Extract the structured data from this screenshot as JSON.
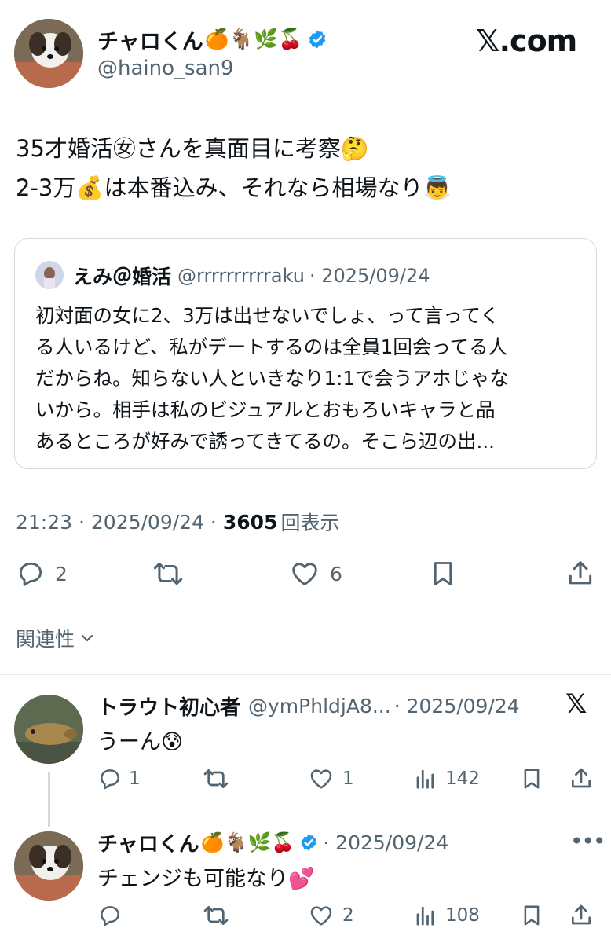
{
  "main_tweet": {
    "author_name": "チャロくん",
    "author_emoji": "🍊🐐🌿🍒",
    "handle": "@haino_san9",
    "site_label": "𝕏.com",
    "text_line1": "35才婚活㊛さんを真面目に考察🤔",
    "text_line2": "2-3万💰は本番込み、それなら相場なり👼",
    "quote": {
      "author_name": "えみ＠婚活",
      "handle": "@rrrrrrrrrraku",
      "date": "· 2025/09/24",
      "lines": [
        "初対面の女に2、3万は出せないでしょ、って言ってく",
        "る人いるけど、私がデートするのは全員1回会ってる人",
        "だからね。知らない人といきなり1:1で会うアホじゃな",
        "いから。相手は私のビジュアルとおもろいキャラと品",
        "あるところが好みで誘ってきてるの。そこら辺の出..."
      ]
    },
    "time": "21:23 · 2025/09/24 ·",
    "views_count": "3605",
    "views_label": "回表示",
    "actions": {
      "reply_count": "2",
      "like_count": "6"
    },
    "related_label": "関連性"
  },
  "replies": [
    {
      "author_name": "トラウト初心者",
      "handle": "@ymPhldjA8...",
      "date": "· 2025/09/24",
      "text": "うーん😰",
      "reply_count": "1",
      "like_count": "1",
      "view_count": "142"
    },
    {
      "author_name": "チャロくん",
      "author_emoji": "🍊🐐🌿🍒",
      "date": "· 2025/09/24",
      "text": "チェンジも可能なり💕",
      "reply_count": "",
      "like_count": "2",
      "view_count": "108"
    }
  ],
  "colors": {
    "verified": "#1d9bf0",
    "text": "#0f1419",
    "dim": "#536471",
    "border": "#cfd9de"
  }
}
